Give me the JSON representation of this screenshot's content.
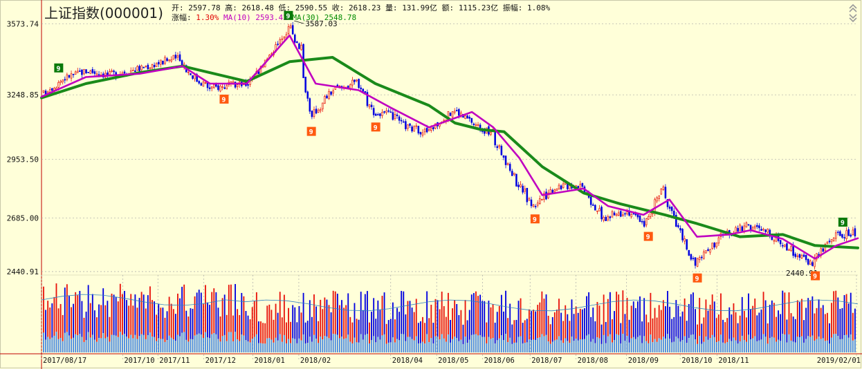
{
  "header": {
    "title": "上证指数(000001)",
    "open_label": "开:",
    "open": "2597.78",
    "high_label": "高:",
    "high": "2618.48",
    "low_label": "低:",
    "low": "2590.55",
    "close_label": "收:",
    "close": "2618.23",
    "volume_label": "量:",
    "volume": "131.99亿",
    "amount_label": "额:",
    "amount": "1115.23亿",
    "amplitude_label": "振幅:",
    "amplitude": "1.08%",
    "change_label": "涨幅:",
    "change": "1.30%",
    "ma10_label": "MA(10)",
    "ma10": "2593.42",
    "ma30_label": "MA(30)",
    "ma30": "2548.78"
  },
  "colors": {
    "background": "#ffffd9",
    "up": "#e8140c",
    "down": "#0000e0",
    "ma10": "#c000c0",
    "ma30": "#1a8a1a",
    "badge_green": "#0a7a0a",
    "badge_orange": "#ff5a10",
    "volume_low": "#4a8ae0",
    "grid": "#a8a8a8"
  },
  "chart_data": {
    "type": "candlestick",
    "title": "上证指数(000001)",
    "y_ticks": [
      3573.74,
      3248.85,
      2953.5,
      2685.0,
      2440.91
    ],
    "ylim": [
      2425,
      3600
    ],
    "x_ticks": [
      "2017/08/17",
      "2017/10",
      "2017/11",
      "2017/12",
      "2018/01",
      "2018/02",
      "2018/04",
      "2018/05",
      "2018/06",
      "2018/07",
      "2018/08",
      "2018/09",
      "2018/10",
      "2018/11",
      "2019/02/01"
    ],
    "annotations": {
      "high_label": "3587.03",
      "high_value": 3587.03,
      "low_label": "2440.91",
      "low_value": 2440.91
    },
    "close_path": [
      {
        "date": "2017-08-17",
        "close": 3255
      },
      {
        "date": "2017-09-01",
        "close": 3330
      },
      {
        "date": "2017-09-15",
        "close": 3360
      },
      {
        "date": "2017-09-29",
        "close": 3340
      },
      {
        "date": "2017-10-20",
        "close": 3370
      },
      {
        "date": "2017-11-13",
        "close": 3420
      },
      {
        "date": "2017-11-24",
        "close": 3330
      },
      {
        "date": "2017-12-05",
        "close": 3280
      },
      {
        "date": "2017-12-29",
        "close": 3300
      },
      {
        "date": "2018-01-12",
        "close": 3420
      },
      {
        "date": "2018-01-26",
        "close": 3560
      },
      {
        "date": "2018-02-02",
        "close": 3460
      },
      {
        "date": "2018-02-09",
        "close": 3140
      },
      {
        "date": "2018-02-23",
        "close": 3270
      },
      {
        "date": "2018-03-12",
        "close": 3310
      },
      {
        "date": "2018-03-23",
        "close": 3160
      },
      {
        "date": "2018-04-02",
        "close": 3160
      },
      {
        "date": "2018-04-13",
        "close": 3100
      },
      {
        "date": "2018-04-27",
        "close": 3080
      },
      {
        "date": "2018-05-14",
        "close": 3180
      },
      {
        "date": "2018-05-31",
        "close": 3100
      },
      {
        "date": "2018-06-08",
        "close": 3070
      },
      {
        "date": "2018-06-22",
        "close": 2880
      },
      {
        "date": "2018-07-05",
        "close": 2740
      },
      {
        "date": "2018-07-20",
        "close": 2830
      },
      {
        "date": "2018-08-06",
        "close": 2840
      },
      {
        "date": "2018-08-20",
        "close": 2680
      },
      {
        "date": "2018-09-04",
        "close": 2720
      },
      {
        "date": "2018-09-17",
        "close": 2660
      },
      {
        "date": "2018-09-28",
        "close": 2820
      },
      {
        "date": "2018-10-11",
        "close": 2600
      },
      {
        "date": "2018-10-19",
        "close": 2470
      },
      {
        "date": "2018-11-05",
        "close": 2600
      },
      {
        "date": "2018-11-23",
        "close": 2650
      },
      {
        "date": "2018-12-07",
        "close": 2620
      },
      {
        "date": "2018-12-21",
        "close": 2540
      },
      {
        "date": "2019-01-04",
        "close": 2480
      },
      {
        "date": "2019-01-18",
        "close": 2600
      },
      {
        "date": "2019-02-01",
        "close": 2618
      }
    ],
    "ma10_path": [
      {
        "date": "2017-08-17",
        "close": 3240
      },
      {
        "date": "2017-09-15",
        "close": 3330
      },
      {
        "date": "2017-10-20",
        "close": 3345
      },
      {
        "date": "2017-11-17",
        "close": 3380
      },
      {
        "date": "2017-12-05",
        "close": 3300
      },
      {
        "date": "2017-12-29",
        "close": 3300
      },
      {
        "date": "2018-01-26",
        "close": 3520
      },
      {
        "date": "2018-02-12",
        "close": 3300
      },
      {
        "date": "2018-03-12",
        "close": 3270
      },
      {
        "date": "2018-04-02",
        "close": 3190
      },
      {
        "date": "2018-04-27",
        "close": 3100
      },
      {
        "date": "2018-05-25",
        "close": 3170
      },
      {
        "date": "2018-06-08",
        "close": 3100
      },
      {
        "date": "2018-06-25",
        "close": 2960
      },
      {
        "date": "2018-07-10",
        "close": 2790
      },
      {
        "date": "2018-08-06",
        "close": 2820
      },
      {
        "date": "2018-08-22",
        "close": 2740
      },
      {
        "date": "2018-09-14",
        "close": 2700
      },
      {
        "date": "2018-10-01",
        "close": 2770
      },
      {
        "date": "2018-10-19",
        "close": 2600
      },
      {
        "date": "2018-11-09",
        "close": 2610
      },
      {
        "date": "2018-11-23",
        "close": 2630
      },
      {
        "date": "2018-12-14",
        "close": 2590
      },
      {
        "date": "2019-01-04",
        "close": 2500
      },
      {
        "date": "2019-01-18",
        "close": 2560
      },
      {
        "date": "2019-02-01",
        "close": 2593
      }
    ],
    "ma30_path": [
      {
        "date": "2017-08-17",
        "close": 3235
      },
      {
        "date": "2017-09-15",
        "close": 3300
      },
      {
        "date": "2017-10-20",
        "close": 3350
      },
      {
        "date": "2017-11-17",
        "close": 3380
      },
      {
        "date": "2017-12-29",
        "close": 3310
      },
      {
        "date": "2018-01-26",
        "close": 3400
      },
      {
        "date": "2018-02-23",
        "close": 3420
      },
      {
        "date": "2018-03-23",
        "close": 3300
      },
      {
        "date": "2018-04-27",
        "close": 3200
      },
      {
        "date": "2018-05-14",
        "close": 3120
      },
      {
        "date": "2018-05-31",
        "close": 3090
      },
      {
        "date": "2018-06-15",
        "close": 3080
      },
      {
        "date": "2018-07-10",
        "close": 2920
      },
      {
        "date": "2018-08-06",
        "close": 2800
      },
      {
        "date": "2018-08-30",
        "close": 2750
      },
      {
        "date": "2018-09-28",
        "close": 2700
      },
      {
        "date": "2018-10-19",
        "close": 2660
      },
      {
        "date": "2018-11-16",
        "close": 2600
      },
      {
        "date": "2018-12-14",
        "close": 2610
      },
      {
        "date": "2019-01-04",
        "close": 2560
      },
      {
        "date": "2019-02-01",
        "close": 2548.78
      }
    ],
    "ma10_last": 2593.42,
    "ma30_last": 2548.78,
    "markers": [
      {
        "date": "2017-08-28",
        "text": "9",
        "kind": "green"
      },
      {
        "date": "2017-12-14",
        "text": "9",
        "kind": "orange"
      },
      {
        "date": "2018-01-25",
        "text": "9",
        "kind": "green"
      },
      {
        "date": "2018-02-09",
        "text": "9",
        "kind": "orange"
      },
      {
        "date": "2018-03-23",
        "text": "9",
        "kind": "orange"
      },
      {
        "date": "2018-07-05",
        "text": "9",
        "kind": "orange"
      },
      {
        "date": "2018-09-17",
        "text": "9",
        "kind": "orange"
      },
      {
        "date": "2018-10-19",
        "text": "9",
        "kind": "orange"
      },
      {
        "date": "2019-01-04",
        "text": "9",
        "kind": "orange"
      },
      {
        "date": "2019-01-22",
        "text": "9",
        "kind": "green"
      }
    ]
  }
}
